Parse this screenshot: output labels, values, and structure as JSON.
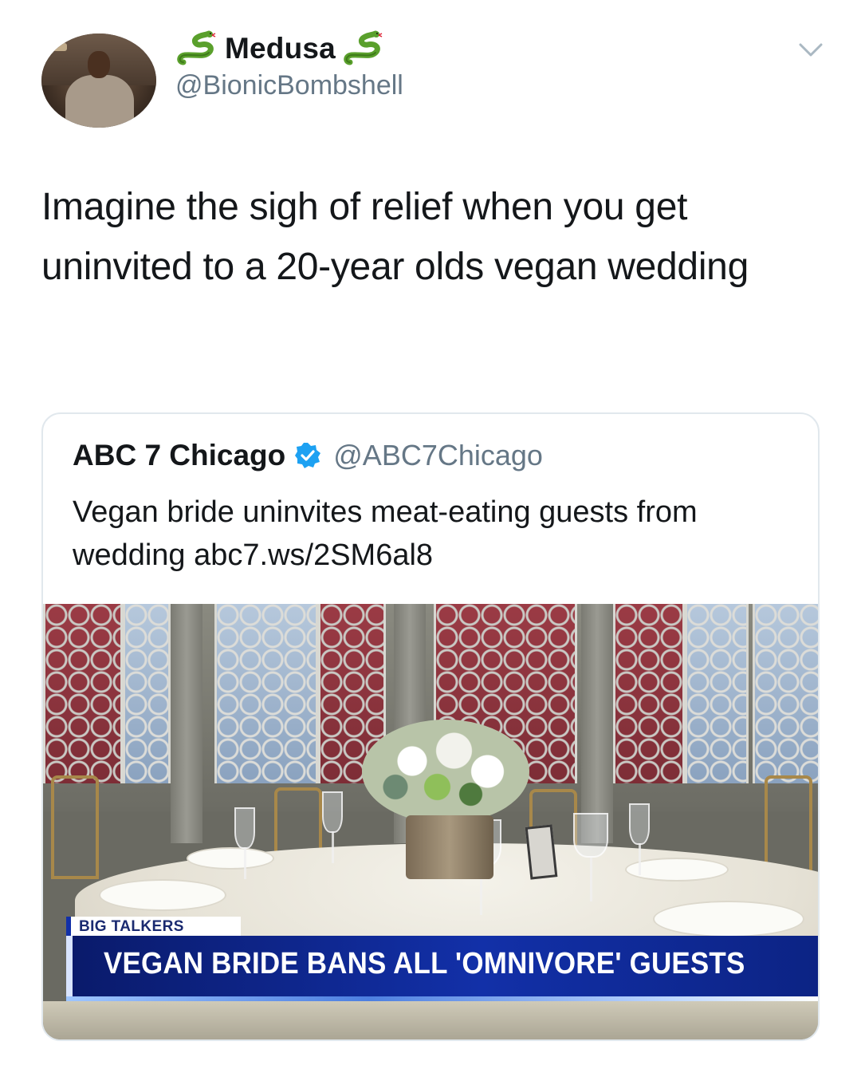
{
  "author": {
    "name": "Medusa",
    "name_emoji": "snake-icon",
    "handle": "@BionicBombshell"
  },
  "tweet": {
    "text": "Imagine the sigh of relief when you get uninvited to a 20-year olds vegan wedding"
  },
  "quoted_tweet": {
    "name": "ABC 7 Chicago",
    "verified": true,
    "handle": "@ABC7Chicago",
    "text": "Vegan bride uninvites meat-eating guests from wedding abc7.ws/2SM6al8",
    "media": {
      "tag": "BIG TALKERS",
      "headline": "VEGAN BRIDE BANS ALL 'OMNIVORE' GUESTS"
    }
  },
  "colors": {
    "text": "#14171a",
    "secondary": "#657786",
    "border": "#e1e8ed",
    "verified": "#1da1f2",
    "chyron_blue": "#1230a8"
  }
}
